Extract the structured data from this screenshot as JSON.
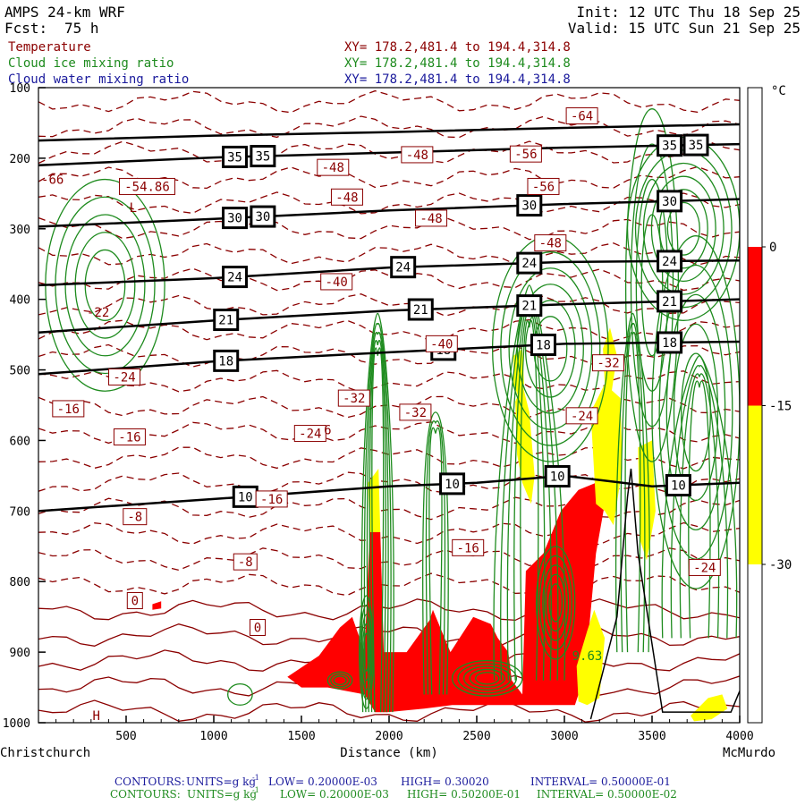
{
  "header": {
    "model": "AMPS 24-km WRF",
    "fcst_label": "Fcst:",
    "fcst_value": "75 h",
    "init": "Init: 12 UTC Thu 18 Sep 25",
    "valid": "Valid: 15 UTC Sun 21 Sep 25"
  },
  "fields": [
    {
      "name": "Temperature",
      "xy": "XY= 178.2,481.4 to 194.4,314.8",
      "color": "#8b0000"
    },
    {
      "name": "Cloud ice mixing ratio",
      "xy": "XY= 178.2,481.4 to 194.4,314.8",
      "color": "#1e8b1e"
    },
    {
      "name": "Cloud water mixing ratio",
      "xy": "XY= 178.2,481.4 to 194.4,314.8",
      "color": "#1a1a9c"
    }
  ],
  "colorbar": {
    "unit": "°C",
    "ticks": [
      "0",
      "-15",
      "-30"
    ],
    "bands": [
      {
        "from": 0,
        "to": -15,
        "color": "#ff0000"
      },
      {
        "from": -15,
        "to": -30,
        "color": "#ffff00"
      }
    ]
  },
  "footer": {
    "line1": {
      "label": "CONTOURS:",
      "units": "UNITS=g kg",
      "exp": "-1",
      "low": "LOW= 0.20000E-03",
      "high": "HIGH= 0.30020",
      "interval": "INTERVAL= 0.50000E-01",
      "color": "#1a1a9c"
    },
    "line2": {
      "label": "CONTOURS:",
      "units": "UNITS=g kg",
      "exp": "-1",
      "low": "LOW= 0.20000E-03",
      "high": "HIGH= 0.50200E-01",
      "interval": "INTERVAL= 0.50000E-02",
      "color": "#1e8b1e"
    }
  },
  "chart_data": {
    "type": "cross-section",
    "xlabel": "Distance (km)",
    "x_start_label": "Christchurch",
    "x_end_label": "McMurdo",
    "xlim": [
      0,
      4000
    ],
    "x_ticks": [
      500,
      1000,
      1500,
      2000,
      2500,
      3000,
      3500,
      4000
    ],
    "ylim": [
      1000,
      100
    ],
    "y_ticks": [
      100,
      200,
      300,
      400,
      500,
      600,
      700,
      800,
      900,
      1000
    ],
    "height_contours": [
      {
        "label": "35",
        "points": [
          [
            0,
            210
          ],
          [
            1000,
            199
          ],
          [
            2000,
            192
          ],
          [
            3000,
            185
          ],
          [
            4000,
            180
          ]
        ],
        "label_x": [
          1120,
          1280,
          3600,
          3750
        ]
      },
      {
        "label": "30",
        "points": [
          [
            0,
            297
          ],
          [
            1000,
            286
          ],
          [
            2000,
            274
          ],
          [
            3000,
            265
          ],
          [
            4000,
            258
          ]
        ],
        "label_x": [
          1120,
          1280,
          2800,
          3600
        ]
      },
      {
        "label": "24",
        "points": [
          [
            0,
            380
          ],
          [
            1000,
            370
          ],
          [
            2000,
            355
          ],
          [
            3000,
            347
          ],
          [
            4000,
            345
          ]
        ],
        "label_x": [
          1120,
          2080,
          2800,
          3600
        ]
      },
      {
        "label": "21",
        "points": [
          [
            0,
            447
          ],
          [
            1000,
            430
          ],
          [
            2000,
            416
          ],
          [
            3000,
            407
          ],
          [
            4000,
            400
          ]
        ],
        "label_x": [
          1070,
          2180,
          2800,
          3600
        ]
      },
      {
        "label": "18",
        "points": [
          [
            0,
            506
          ],
          [
            1000,
            488
          ],
          [
            2000,
            475
          ],
          [
            3000,
            463
          ],
          [
            4000,
            460
          ]
        ],
        "label_x": [
          1070,
          2310,
          2880,
          3600
        ]
      },
      {
        "label": "10",
        "points": [
          [
            0,
            700
          ],
          [
            1000,
            683
          ],
          [
            2000,
            665
          ],
          [
            2500,
            660
          ],
          [
            3000,
            650
          ],
          [
            3500,
            665
          ],
          [
            4000,
            660
          ]
        ],
        "label_x": [
          1180,
          2360,
          2960,
          3650
        ]
      }
    ],
    "upper_contour": {
      "points": [
        [
          0,
          175
        ],
        [
          1000,
          168
        ],
        [
          2000,
          163
        ],
        [
          3000,
          157
        ],
        [
          4000,
          152
        ]
      ]
    },
    "temperature_labels": [
      {
        "label": "-64",
        "x": 3100,
        "y": 140
      },
      {
        "label": "-56",
        "x": 2780,
        "y": 194
      },
      {
        "label": "-48",
        "x": 1680,
        "y": 213
      },
      {
        "label": "-48",
        "x": 2160,
        "y": 195
      },
      {
        "label": "-48",
        "x": 1760,
        "y": 255
      },
      {
        "label": "-48",
        "x": 2240,
        "y": 285
      },
      {
        "label": "-48",
        "x": 2920,
        "y": 320
      },
      {
        "label": "-40",
        "x": 1700,
        "y": 375
      },
      {
        "label": "-40",
        "x": 2300,
        "y": 463
      },
      {
        "label": "-56",
        "x": 2880,
        "y": 240
      },
      {
        "label": "-54.86",
        "x": 620,
        "y": 240
      },
      {
        "label": "-32",
        "x": 1800,
        "y": 540
      },
      {
        "label": "-32",
        "x": 2150,
        "y": 560
      },
      {
        "label": "-32",
        "x": 3250,
        "y": 490
      },
      {
        "label": "-24",
        "x": 490,
        "y": 510
      },
      {
        "label": "-24",
        "x": 1550,
        "y": 590
      },
      {
        "label": "-24",
        "x": 3100,
        "y": 565
      },
      {
        "label": "-24",
        "x": 3800,
        "y": 780
      },
      {
        "label": "-16",
        "x": 170,
        "y": 555
      },
      {
        "label": "-16",
        "x": 520,
        "y": 595
      },
      {
        "label": "-16",
        "x": 1330,
        "y": 683
      },
      {
        "label": "-16",
        "x": 2450,
        "y": 752
      },
      {
        "label": "-8",
        "x": 550,
        "y": 708
      },
      {
        "label": "-8",
        "x": 1180,
        "y": 772
      },
      {
        "label": "0",
        "x": 550,
        "y": 827
      },
      {
        "label": "0",
        "x": 1250,
        "y": 865
      }
    ],
    "temperature_shading": [
      {
        "range": "0 to -15",
        "color": "#ff0000"
      },
      {
        "range": "-15 to -30",
        "color": "#ffff00"
      }
    ],
    "annotations": [
      {
        "label": "L",
        "x": 540,
        "y": 270
      },
      {
        "label": "H",
        "x": 330,
        "y": 990
      },
      {
        "label": "-66",
        "x": 80,
        "y": 230
      },
      {
        "label": "-22",
        "x": 340,
        "y": 418
      },
      {
        "label": "9.63",
        "x": 3130,
        "y": 905
      },
      {
        "label": "6",
        "x": 1650,
        "y": 585
      }
    ]
  }
}
